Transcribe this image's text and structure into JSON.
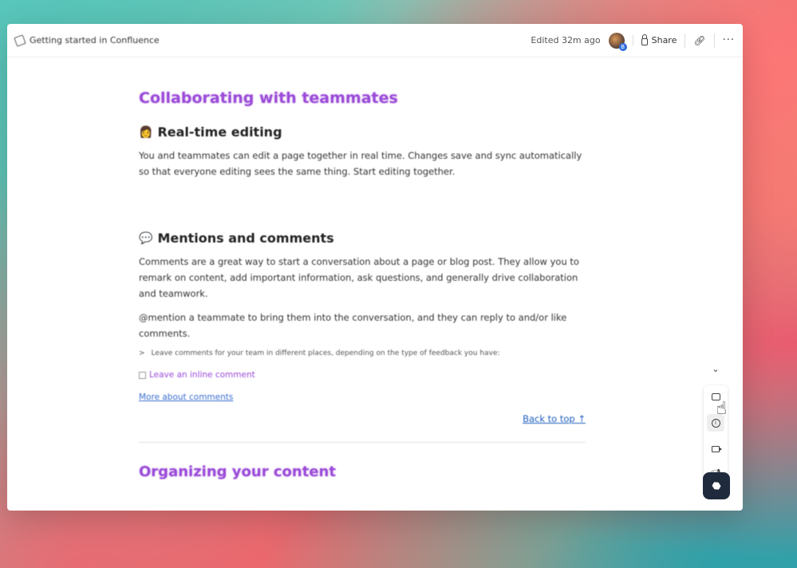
{
  "breadcrumb": {
    "label": "Getting started in Confluence"
  },
  "header": {
    "edited": "Edited 32m ago",
    "avatar_badge": "B",
    "share_label": "Share",
    "more_label": "···"
  },
  "content": {
    "section1_title": "Collaborating with teammates",
    "realtime": {
      "emoji": "👩",
      "title": "Real-time editing",
      "body": "You and teammates can edit a page together in real time. Changes save and sync automatically so that everyone editing sees the same thing. Start editing together."
    },
    "mentions": {
      "emoji": "💬",
      "title": "Mentions and comments",
      "body1": "Comments are a great way to start a conversation about a page or blog post. They allow you to remark on content, add important information, ask questions, and generally drive collaboration and teamwork.",
      "body2": "@mention a teammate to bring them into the conversation, and they can reply to and/or like comments.",
      "expand": "Leave comments for your team in different places, depending on the type of feedback you have:",
      "inline_link": "Leave an inline comment",
      "more_link": "More about comments"
    },
    "back_to_top": "Back to top ↑",
    "section2_title": "Organizing your content"
  },
  "rail": {
    "chevron": "⌄",
    "items": [
      "comment-icon",
      "info-icon",
      "video-icon",
      "megaphone-icon"
    ]
  }
}
